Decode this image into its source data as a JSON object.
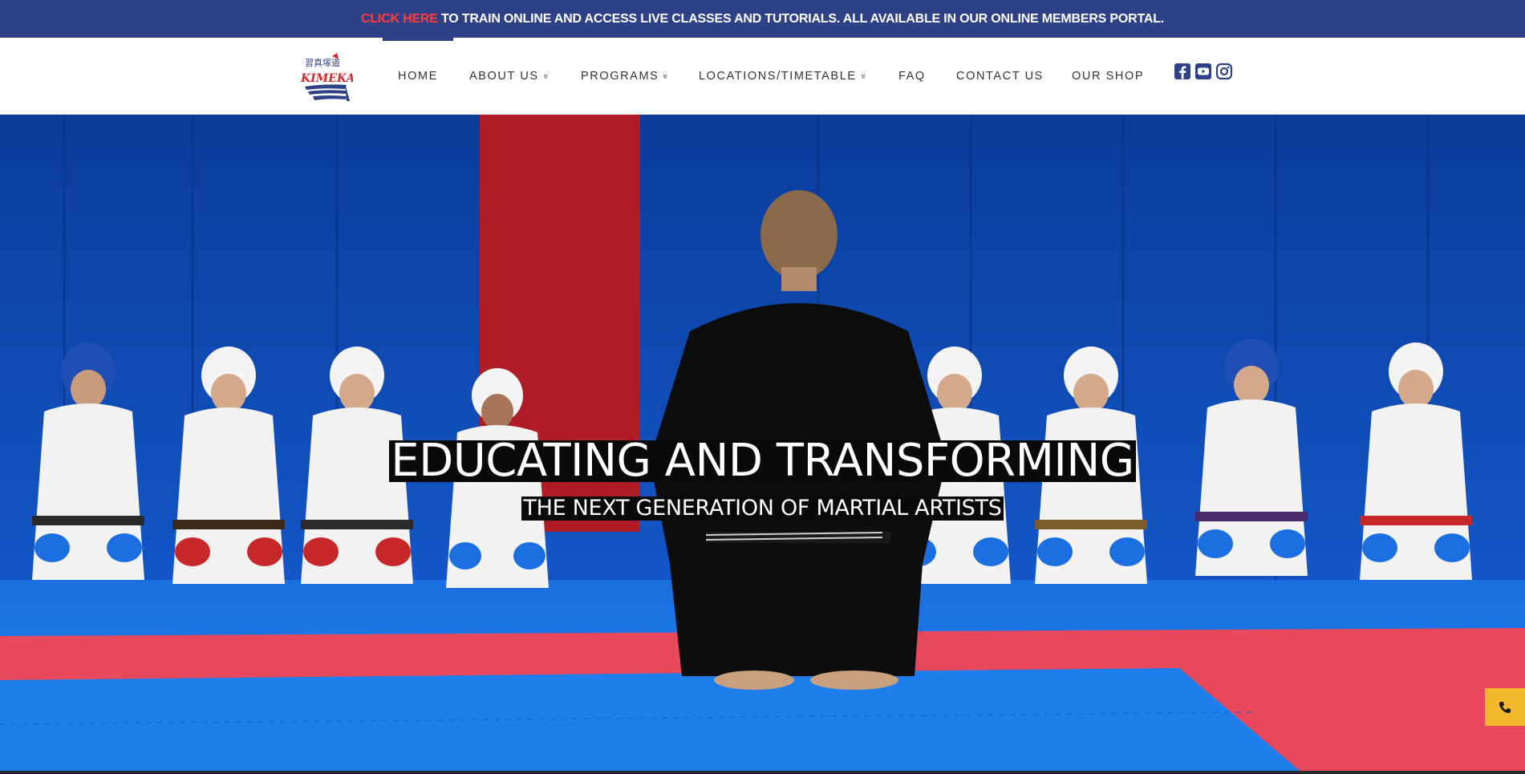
{
  "announcement": {
    "link_text": "CLICK HERE",
    "text": " TO TRAIN ONLINE AND ACCESS LIVE CLASSES AND TUTORIALS. ALL AVAILABLE IN OUR ONLINE MEMBERS PORTAL."
  },
  "logo": {
    "kanji": "習真塚道",
    "name": "KIMEKAI"
  },
  "nav": {
    "items": [
      {
        "label": "HOME"
      },
      {
        "label": "ABOUT US",
        "chevron": "»"
      },
      {
        "label": "PROGRAMS",
        "chevron": "»"
      },
      {
        "label": "LOCATIONS/TIMETABLE",
        "chevron": "»"
      },
      {
        "label": "FAQ"
      },
      {
        "label": "CONTACT US"
      },
      {
        "label": "OUR SHOP"
      }
    ],
    "active_index": 0
  },
  "social": [
    "facebook-icon",
    "youtube-icon",
    "instagram-icon"
  ],
  "hero": {
    "title": "EDUCATING AND TRANSFORMING",
    "subtitle": "THE NEXT GENERATION OF MARTIAL ARTISTS"
  },
  "colors": {
    "brand_navy": "#2f4186",
    "link_red": "#ff3b3b",
    "mat_blue": "#1a73e8",
    "mat_red": "#e84a5f",
    "phone_button": "#f4b82c"
  }
}
